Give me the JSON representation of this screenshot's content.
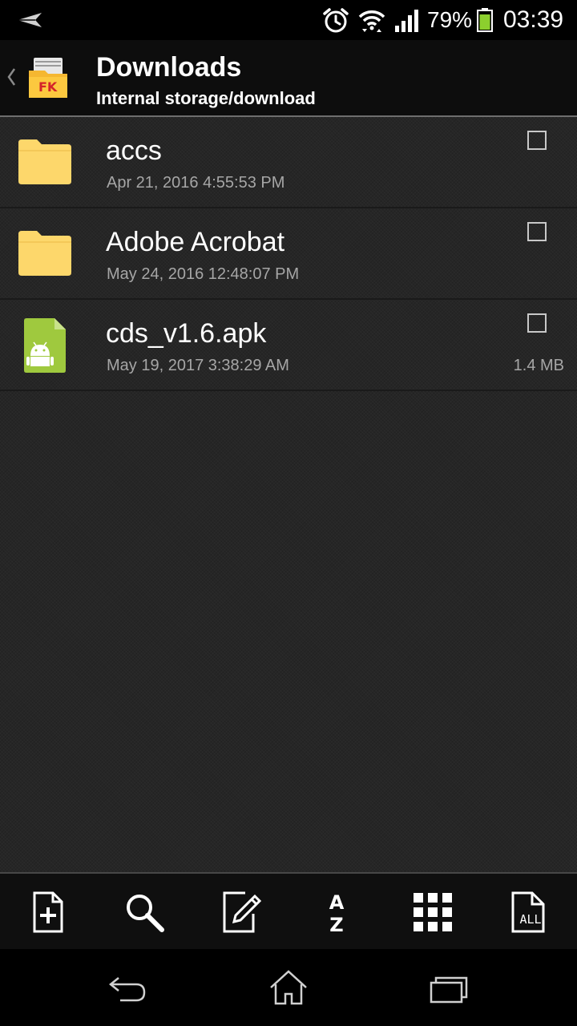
{
  "status_bar": {
    "battery_percent": "79%",
    "time": "03:39",
    "icons": [
      "send-icon",
      "alarm-icon",
      "wifi-icon",
      "signal-icon",
      "battery-icon"
    ]
  },
  "action_bar": {
    "title": "Downloads",
    "subtitle": "Internal storage/download",
    "app_logo_text": "FK"
  },
  "files": [
    {
      "name": "accs",
      "date": "Apr 21, 2016 4:55:53 PM",
      "size": "",
      "type": "folder",
      "checked": false
    },
    {
      "name": "Adobe Acrobat",
      "date": "May 24, 2016 12:48:07 PM",
      "size": "",
      "type": "folder",
      "checked": false
    },
    {
      "name": "cds_v1.6.apk",
      "date": "May 19, 2017 3:38:29 AM",
      "size": "1.4 MB",
      "type": "apk",
      "checked": false
    }
  ],
  "toolbar": {
    "buttons": [
      "new-file-icon",
      "search-icon",
      "edit-icon",
      "sort-az-icon",
      "grid-view-icon",
      "select-all-icon"
    ],
    "sort_label_top": "A",
    "sort_label_bottom": "Z",
    "select_all_label": "ALL"
  },
  "nav_bar": {
    "buttons": [
      "back-icon",
      "home-icon",
      "recents-icon"
    ]
  },
  "colors": {
    "folder": "#fdd76b",
    "apk": "#9fc93e",
    "secondary_text": "#a6a6a6",
    "battery": "#8ccf2e"
  }
}
